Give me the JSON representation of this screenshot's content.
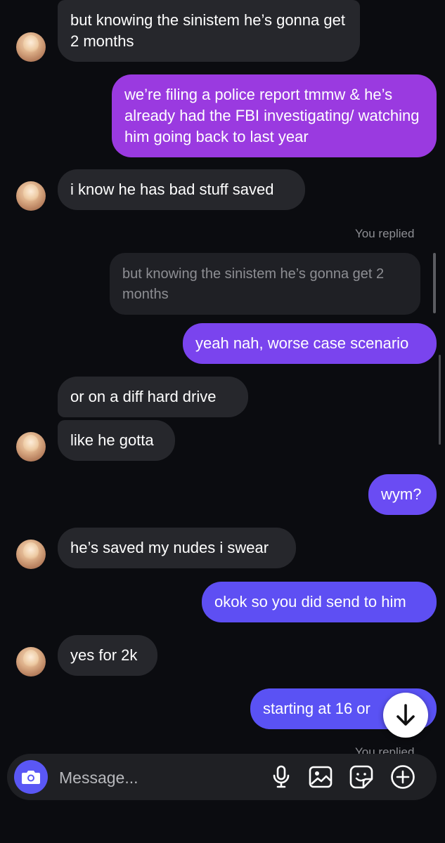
{
  "messages": [
    {
      "from": "them",
      "text": "but knowing the sinistem he’s gonna get 2 months"
    },
    {
      "from": "me",
      "text": "we’re filing a police report tmmw & he’s already had the FBI investigating/ watching him going back to last year"
    },
    {
      "from": "them",
      "text": "i know he has bad stuff saved"
    },
    {
      "from": "me",
      "reply_label": "You replied",
      "quoted": "but knowing the sinistem he’s gonna get 2 months",
      "text": "yeah nah, worse case scenario"
    },
    {
      "from": "them",
      "text": "or  on a diff hard drive"
    },
    {
      "from": "them",
      "text": "like he gotta"
    },
    {
      "from": "me",
      "text": "wym?"
    },
    {
      "from": "them",
      "text": "he’s saved my nudes i swear"
    },
    {
      "from": "me",
      "text": "okok so you did send to him"
    },
    {
      "from": "them",
      "text": "yes for 2k"
    },
    {
      "from": "me",
      "text": "starting at 16 or"
    },
    {
      "from": "me",
      "reply_label": "You replied"
    }
  ],
  "composer": {
    "placeholder": "Message...",
    "icons": [
      "camera-icon",
      "microphone-icon",
      "image-icon",
      "sticker-icon",
      "plus-circle-icon"
    ]
  },
  "scroll_down_icon": "arrow-down-icon",
  "colors": {
    "background": "#0b0c10",
    "incoming_bubble": "#26272c",
    "outgoing_purple": "#9a3ae0",
    "outgoing_blue": "#5a52f4",
    "camera_button": "#5a57f5"
  }
}
